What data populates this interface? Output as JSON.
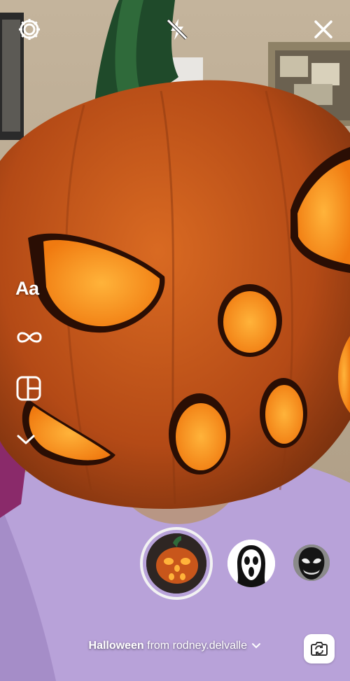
{
  "top_bar": {
    "settings_icon": "gear-icon",
    "flash_icon": "flash-off-icon",
    "close_icon": "close-icon"
  },
  "side_tools": {
    "text_label": "Aa",
    "boomerang_icon": "infinity-icon",
    "layout_icon": "layout-grid-icon",
    "more_icon": "chevron-down-icon"
  },
  "effects": {
    "selected": "pumpkin-effect",
    "items": [
      "pumpkin-effect",
      "ghostface-effect",
      "venom-effect"
    ]
  },
  "attribution": {
    "effect_name": "Halloween",
    "from_text": " from rodney.delvalle"
  },
  "flip_camera_icon": "camera-flip-icon",
  "colors": {
    "pumpkin": "#c8561b",
    "pumpkin_glow": "#ff9a1e",
    "stem": "#1f4a2a",
    "shirt": "#b8a2d9",
    "wall": "#b3a38b"
  }
}
